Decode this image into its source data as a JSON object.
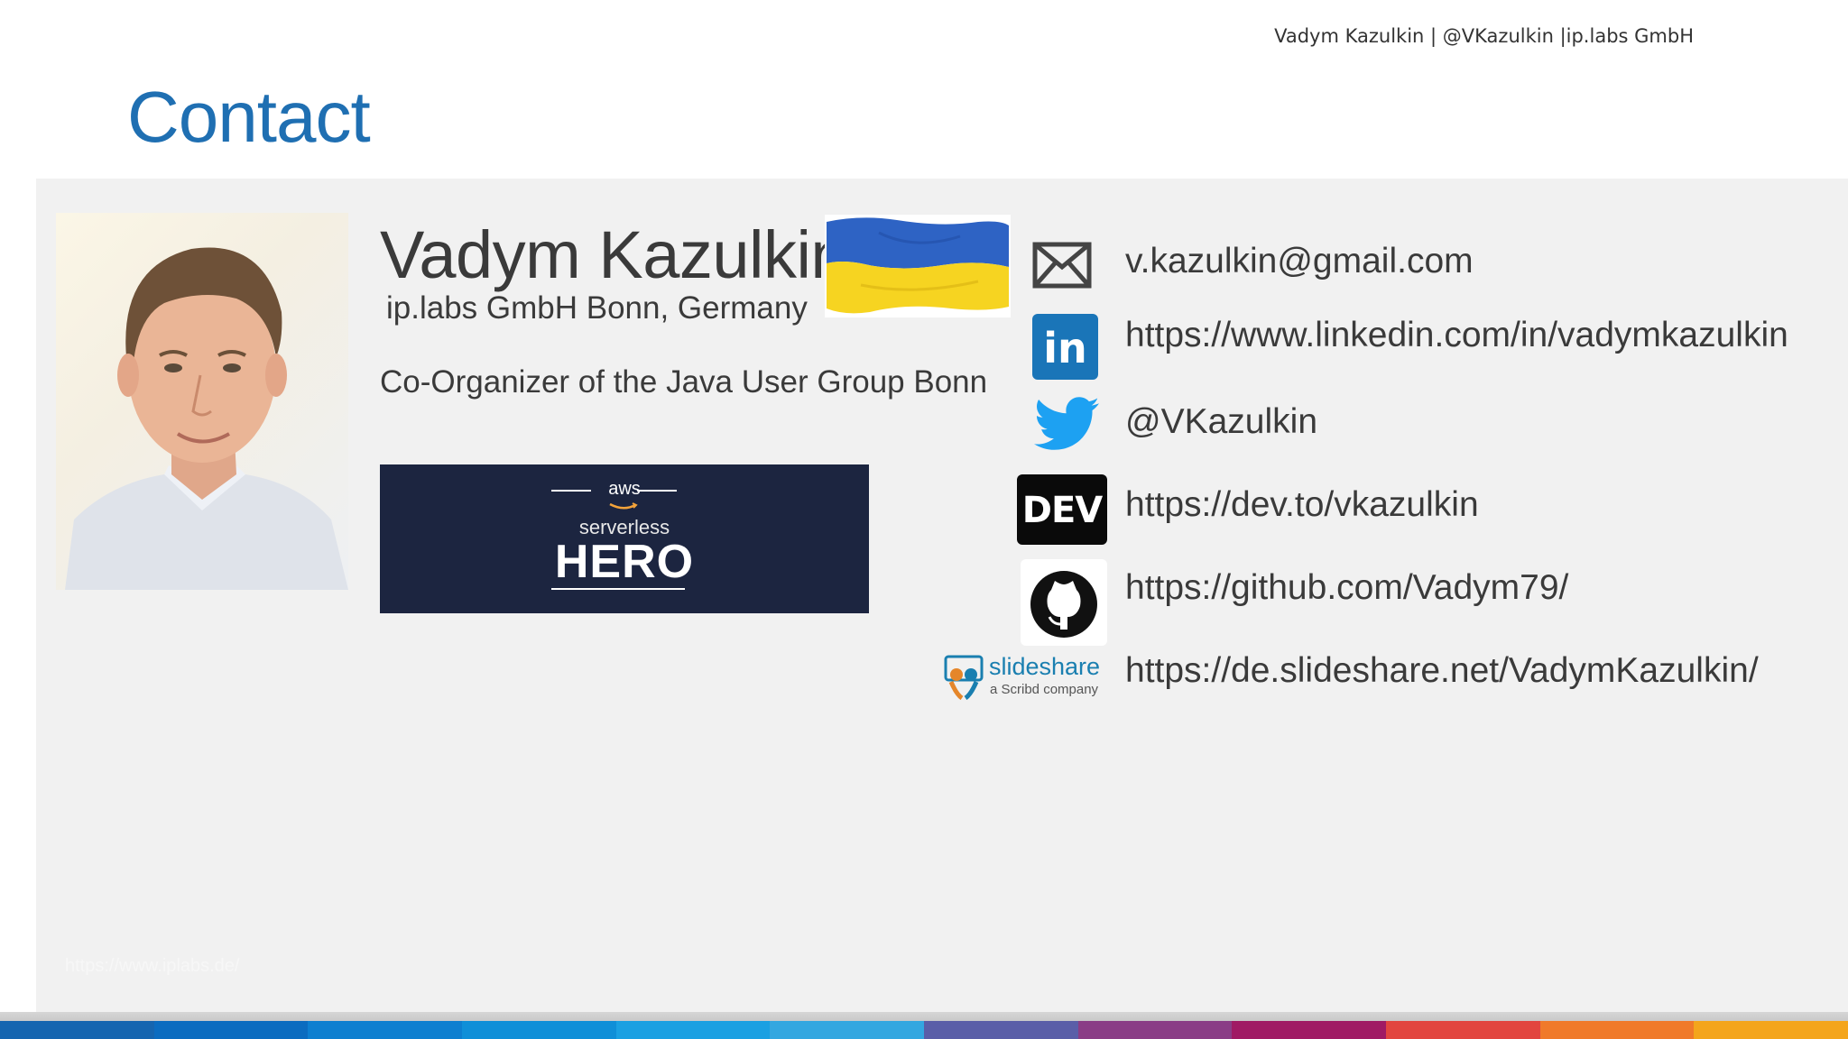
{
  "header": {
    "byline": "Vadym Kazulkin | @VKazulkin |ip.labs GmbH"
  },
  "title": "Contact",
  "profile": {
    "name": "Vadym Kazulkin",
    "company": "ip.labs GmbH Bonn, Germany",
    "role": "Co-Organizer of the Java User Group Bonn"
  },
  "badge": {
    "top": "aws",
    "subtitle": "serverless",
    "title": "HERO"
  },
  "contacts": {
    "email": "v.kazulkin@gmail.com",
    "linkedin": "https://www.linkedin.com/in/vadymkazulkin",
    "twitter": "@VKazulkin",
    "dev": "https://dev.to/vkazulkin",
    "github": "https://github.com/Vadym79/",
    "slideshare": "https://de.slideshare.net/VadymKazulkin/"
  },
  "icons": {
    "email": "mail-icon",
    "linkedin": "linkedin-icon",
    "twitter": "twitter-icon",
    "dev": "dev-icon",
    "github": "github-icon",
    "slideshare": "slideshare-icon",
    "dev_label": "DEV",
    "linkedin_label": "in",
    "slideshare_label": "slideshare",
    "slideshare_sub": "a Scribd company"
  },
  "footer": {
    "url": "https://www.iplabs.de/"
  },
  "colors": {
    "title": "#1f6fb2",
    "stripes": [
      "#1565b0",
      "#0b6cc0",
      "#0d7fd0",
      "#0f8fd8",
      "#1aa0e2",
      "#33a7e0",
      "#5a5ea8",
      "#8a3d86",
      "#a01a64",
      "#e2453f",
      "#f07a2a",
      "#f4a51c"
    ]
  }
}
